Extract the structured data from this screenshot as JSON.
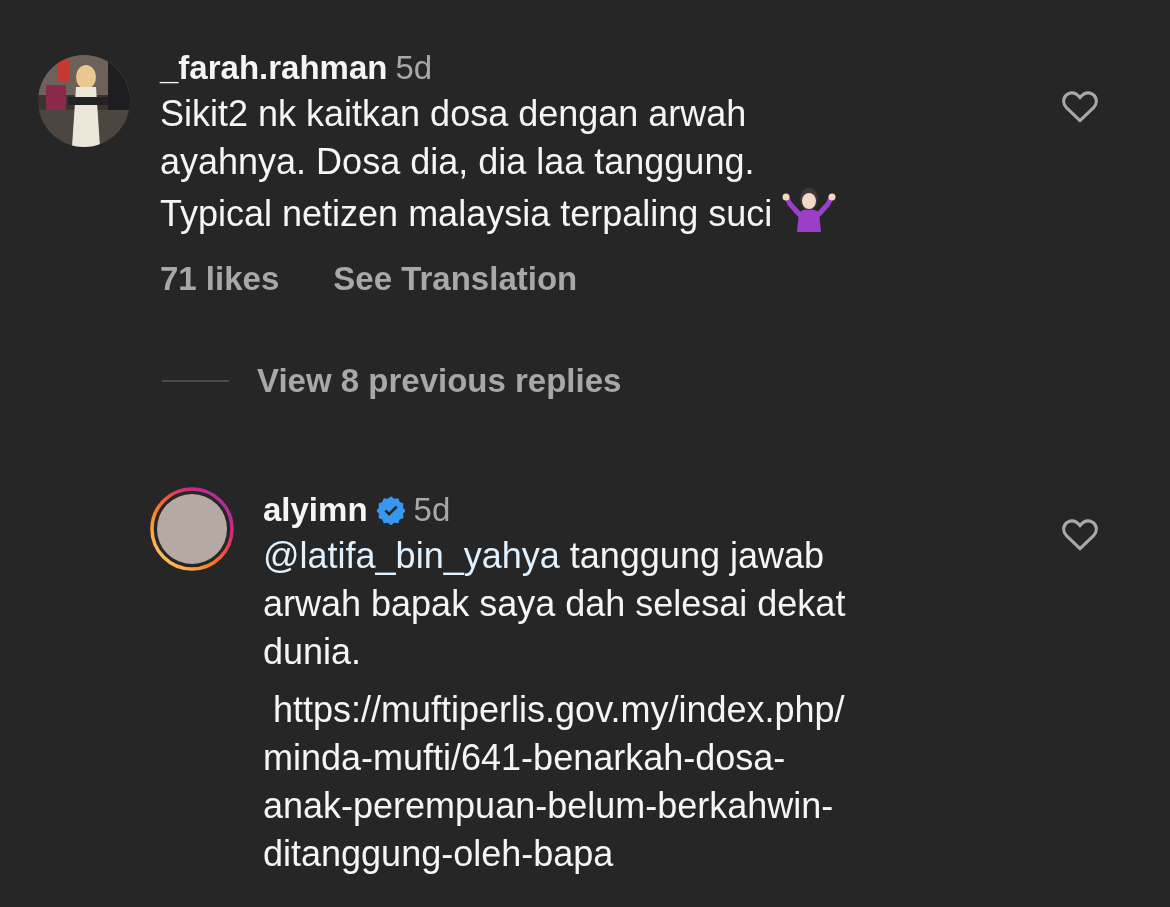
{
  "comments": [
    {
      "username": "_farah.rahman",
      "verified": false,
      "has_story": false,
      "time": "5d",
      "liked": false,
      "lines": [
        "Sikit2 nk kaitkan dosa dengan arwah",
        "ayahnya. Dosa dia, dia laa tanggung.",
        "Typical netizen malaysia terpaling suci"
      ],
      "likes": "71 likes",
      "translate": "See Translation"
    }
  ],
  "view_replies": "View 8 previous replies",
  "reply": {
    "username": "alyimn",
    "verified": true,
    "has_story": true,
    "time": "5d",
    "liked": false,
    "mention": "@latifa_bin_yahya",
    "lines": [
      "tanggung jawab",
      "arwah bapak saya dah selesai dekat",
      "dunia."
    ],
    "link_lines": [
      " https://muftiperlis.gov.my/index.php/",
      "minda-mufti/641-benarkah-dosa-",
      "anak-perempuan-belum-berkahwin-",
      "ditanggung-oleh-bapa"
    ]
  }
}
